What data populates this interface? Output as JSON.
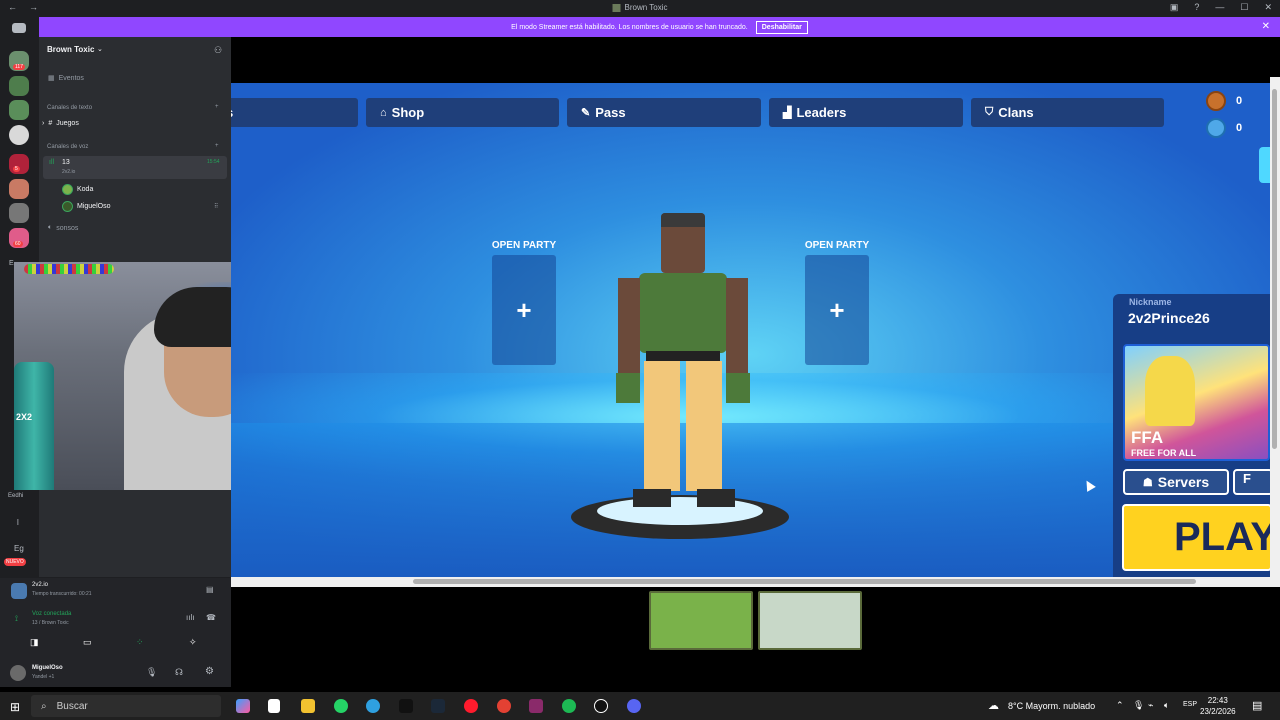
{
  "window": {
    "title": "Brown Toxic",
    "nav_back": "←",
    "nav_forward": "→"
  },
  "banner": {
    "text": "El modo Streamer está habilitado. Los nombres de usuario se han truncado.",
    "button": "Deshabilitar",
    "close": "✕"
  },
  "rail": {
    "badges": [
      "117",
      "5",
      "60"
    ],
    "labels": [
      "E",
      "Eedhi",
      "l",
      "Eg"
    ],
    "new_badge": "NUEVO"
  },
  "sidebar": {
    "server_name": "Brown Toxic",
    "events": "Eventos",
    "text_section": "Canales de texto",
    "text_channels": [
      "Juegos"
    ],
    "voice_section": "Canales de voz",
    "voice_channel": {
      "name": "13",
      "activity": "2v2.io",
      "time": "15:54"
    },
    "voice_users": [
      "Koda",
      "MiguelOso"
    ],
    "other_channel": "sonsos"
  },
  "activity": {
    "name": "2v2.io",
    "elapsed": "Tiempo transcurrido: 00:21"
  },
  "voice_panel": {
    "status": "Voz conectada",
    "location": "13 / Brown Toxic"
  },
  "user_panel": {
    "name": "MiguelOso",
    "status": "Yandel +1"
  },
  "webcam": {
    "bottle_label": "2X2"
  },
  "game": {
    "tabs": [
      {
        "label": "ns",
        "icon": ""
      },
      {
        "label": "Shop",
        "icon": "shop-icon"
      },
      {
        "label": "Pass",
        "icon": "ticket-icon"
      },
      {
        "label": "Leaders",
        "icon": "podium-icon"
      },
      {
        "label": "Clans",
        "icon": "shield-icon"
      }
    ],
    "coins": "0",
    "gems": "0",
    "party_left": "OPEN PARTY",
    "party_right": "OPEN PARTY",
    "party_plus": "+",
    "nickname_label": "Nickname",
    "nickname": "2v2Prince26",
    "mode_title": "FFA",
    "mode_sub": "FREE FOR ALL",
    "servers_button": "Servers",
    "extra_button": "F",
    "play_button": "PLAY"
  },
  "taskbar": {
    "search_placeholder": "Buscar",
    "weather": "8°C  Mayorm. nublado",
    "language": "ESP",
    "time": "22:43",
    "date": "23/2/2026"
  },
  "colors": {
    "banner": "#9047ff",
    "discord_bg": "#2b2d31",
    "play": "#ffd21f",
    "tab": "#1f3f7a"
  }
}
